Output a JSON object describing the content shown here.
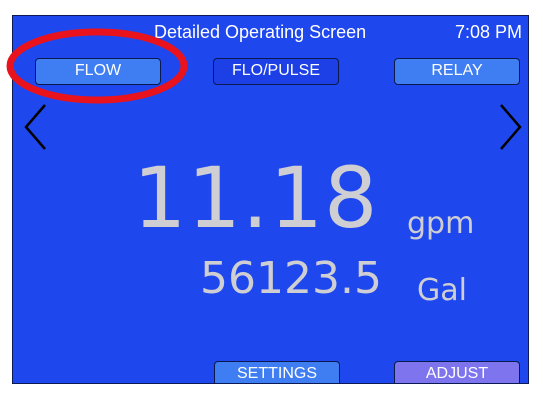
{
  "header": {
    "title": "Detailed Operating Screen",
    "time": "7:08 PM"
  },
  "top_buttons": {
    "flow": "FLOW",
    "flo_pulse": "FLO/PULSE",
    "relay": "RELAY"
  },
  "navigation": {
    "prev_icon": "chevron-left-icon",
    "next_icon": "chevron-right-icon"
  },
  "readings": {
    "flow_rate": "11.18",
    "flow_rate_unit": "gpm",
    "total": "56123.5",
    "total_unit": "Gal"
  },
  "bottom_buttons": {
    "settings": "SETTINGS",
    "adjust": "ADJUST"
  },
  "colors": {
    "screen_background": "#1f47ee",
    "button_light": "#3f7df2",
    "button_adjust": "#7d74ee",
    "reading_text": "#cfcfd3",
    "highlight_ring": "#e8131d"
  }
}
